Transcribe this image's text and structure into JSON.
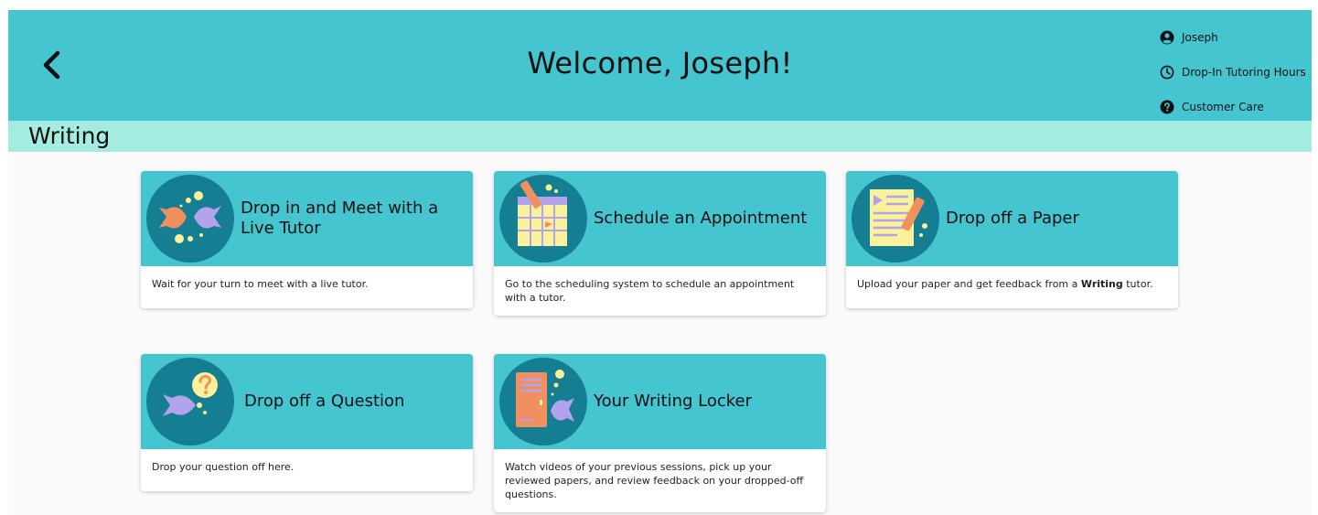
{
  "header": {
    "title": "Welcome, Joseph!",
    "back_icon": "chevron-left-icon"
  },
  "user_menu": {
    "items": [
      {
        "label": "Joseph",
        "icon": "user-circle-icon"
      },
      {
        "label": "Drop-In Tutoring Hours",
        "icon": "clock-icon"
      },
      {
        "label": "Customer Care",
        "icon": "question-circle-icon"
      }
    ]
  },
  "section": {
    "title": "Writing"
  },
  "cards": [
    {
      "title": "Drop in and Meet with a Live Tutor",
      "description": "Wait for your turn to meet with a live tutor.",
      "icon": "two-fish-icon"
    },
    {
      "title": "Schedule an Appointment",
      "description": "Go to the scheduling system to schedule an appointment with a tutor.",
      "icon": "calendar-pencil-icon"
    },
    {
      "title": "Drop off a Paper",
      "description_pre": "Upload your paper and get feedback from a ",
      "description_bold": "Writing",
      "description_post": " tutor.",
      "icon": "paper-pencil-icon"
    },
    {
      "title": "Drop off a Question",
      "description": "Drop your question off here.",
      "icon": "fish-question-icon"
    },
    {
      "title": "Your Writing Locker",
      "description": "Watch videos of your previous sessions, pick up your reviewed papers, and review feedback on your dropped-off questions.",
      "icon": "locker-fish-icon"
    }
  ],
  "colors": {
    "header": "#44c5d0",
    "subheader": "#a3ecdf",
    "icon_circle": "#167e92",
    "fish_orange": "#f28f5e",
    "fish_purple": "#b1a3ec",
    "bubble_yellow": "#fbf19a"
  }
}
